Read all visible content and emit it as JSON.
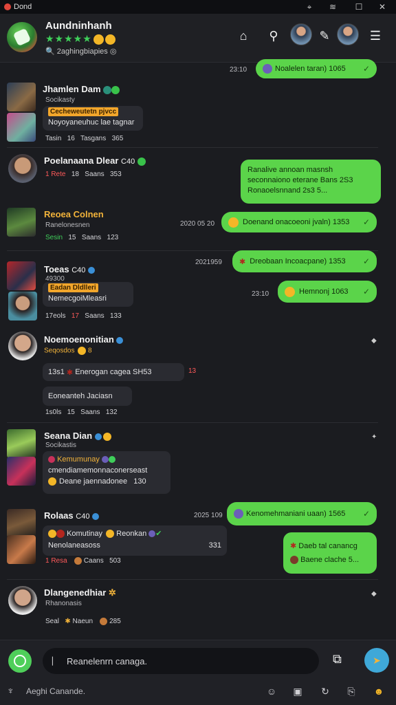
{
  "titlebar": {
    "app_title": "Dond"
  },
  "header": {
    "name": "Aundninhanh",
    "stars": "★★★★★",
    "subline": "2aghingbiapies"
  },
  "chats": [
    {
      "name": "Jhamlen Dam",
      "sub": "Socikasty",
      "tag": "Cecheweutetn pjvcc",
      "preview": "Noyoyaneuhuc lae tagnar",
      "meta_a": "Tasin",
      "meta_b": "16",
      "meta_c": "Tasgans",
      "meta_d": "365"
    },
    {
      "name": "Poelanaana Dlear",
      "extra": "C40",
      "meta_a": "1 Rete",
      "meta_b": "18",
      "meta_c": "Saans",
      "meta_d": "353"
    },
    {
      "name": "Reoea Colnen",
      "sub": "Ranelonesnen",
      "meta_a": "Sesin",
      "meta_b": "15",
      "meta_c": "Saans",
      "meta_d": "123"
    },
    {
      "name": "Toeas",
      "extra": "C40",
      "sub": "49300",
      "tag": "Eadan Dldlleri",
      "preview": "NemecgoiMleasri",
      "meta_a": "17eols",
      "meta_b": "17",
      "meta_c": "Saans",
      "meta_d": "133"
    },
    {
      "name": "Noemoenonitian",
      "sub": "Seqosdos",
      "sub_num": "8",
      "bubble1": "Enerogan cagea SH53",
      "bubble1_time": "13s1",
      "bubble1_num": "13",
      "bubble2": "Eoneanteh Jaciasn",
      "meta_a": "1s0ls",
      "meta_b": "15",
      "meta_c": "Saans",
      "meta_d": "132"
    },
    {
      "name": "Seana Dian",
      "sub": "Socikastis",
      "line1": "Kemumunay",
      "line2": "cmendiamemonnaconerseast",
      "line3": "Deane jaennadonee",
      "line3_num": "130"
    },
    {
      "name": "Rolaas",
      "extra": "C40",
      "line1": "Komutinay",
      "line1b": "Reonkan",
      "line2": "Nenolaneasoss",
      "line2_num": "331",
      "meta_a": "1 Resa",
      "meta_b": "",
      "meta_c": "Caans",
      "meta_d": "503"
    },
    {
      "name": "Dlangenedhiar",
      "sub": "Rhanonasis",
      "meta_a": "Seal",
      "meta_c": "Naeun",
      "meta_d": "285"
    }
  ],
  "outgoing": [
    {
      "time": "23:10",
      "text": "Noalelen taran) 1065"
    },
    {
      "text1": "Ranalive annoan masnsh",
      "text2": "seconnaiono eterane Bans 2S3",
      "text3": "Ronaoelsnnand 2s3 5..."
    },
    {
      "time": "2020 05 20",
      "text": "Doenand onacoeoni jvaln) 1353"
    },
    {
      "time": "2021959",
      "text": "Dreobaan Incoacpane) 1353"
    },
    {
      "time": "23:10",
      "text": "Hemnonj 1063"
    },
    {
      "time": "2025 109",
      "text": "Kenomehmaniani uaan) 1565"
    },
    {
      "text1": "Daeb tal canancg",
      "text2": "Baene clache 5..."
    }
  ],
  "composer": {
    "placeholder": "Reanelenrn canaga.",
    "footer_label": "Aeghi Canande."
  }
}
